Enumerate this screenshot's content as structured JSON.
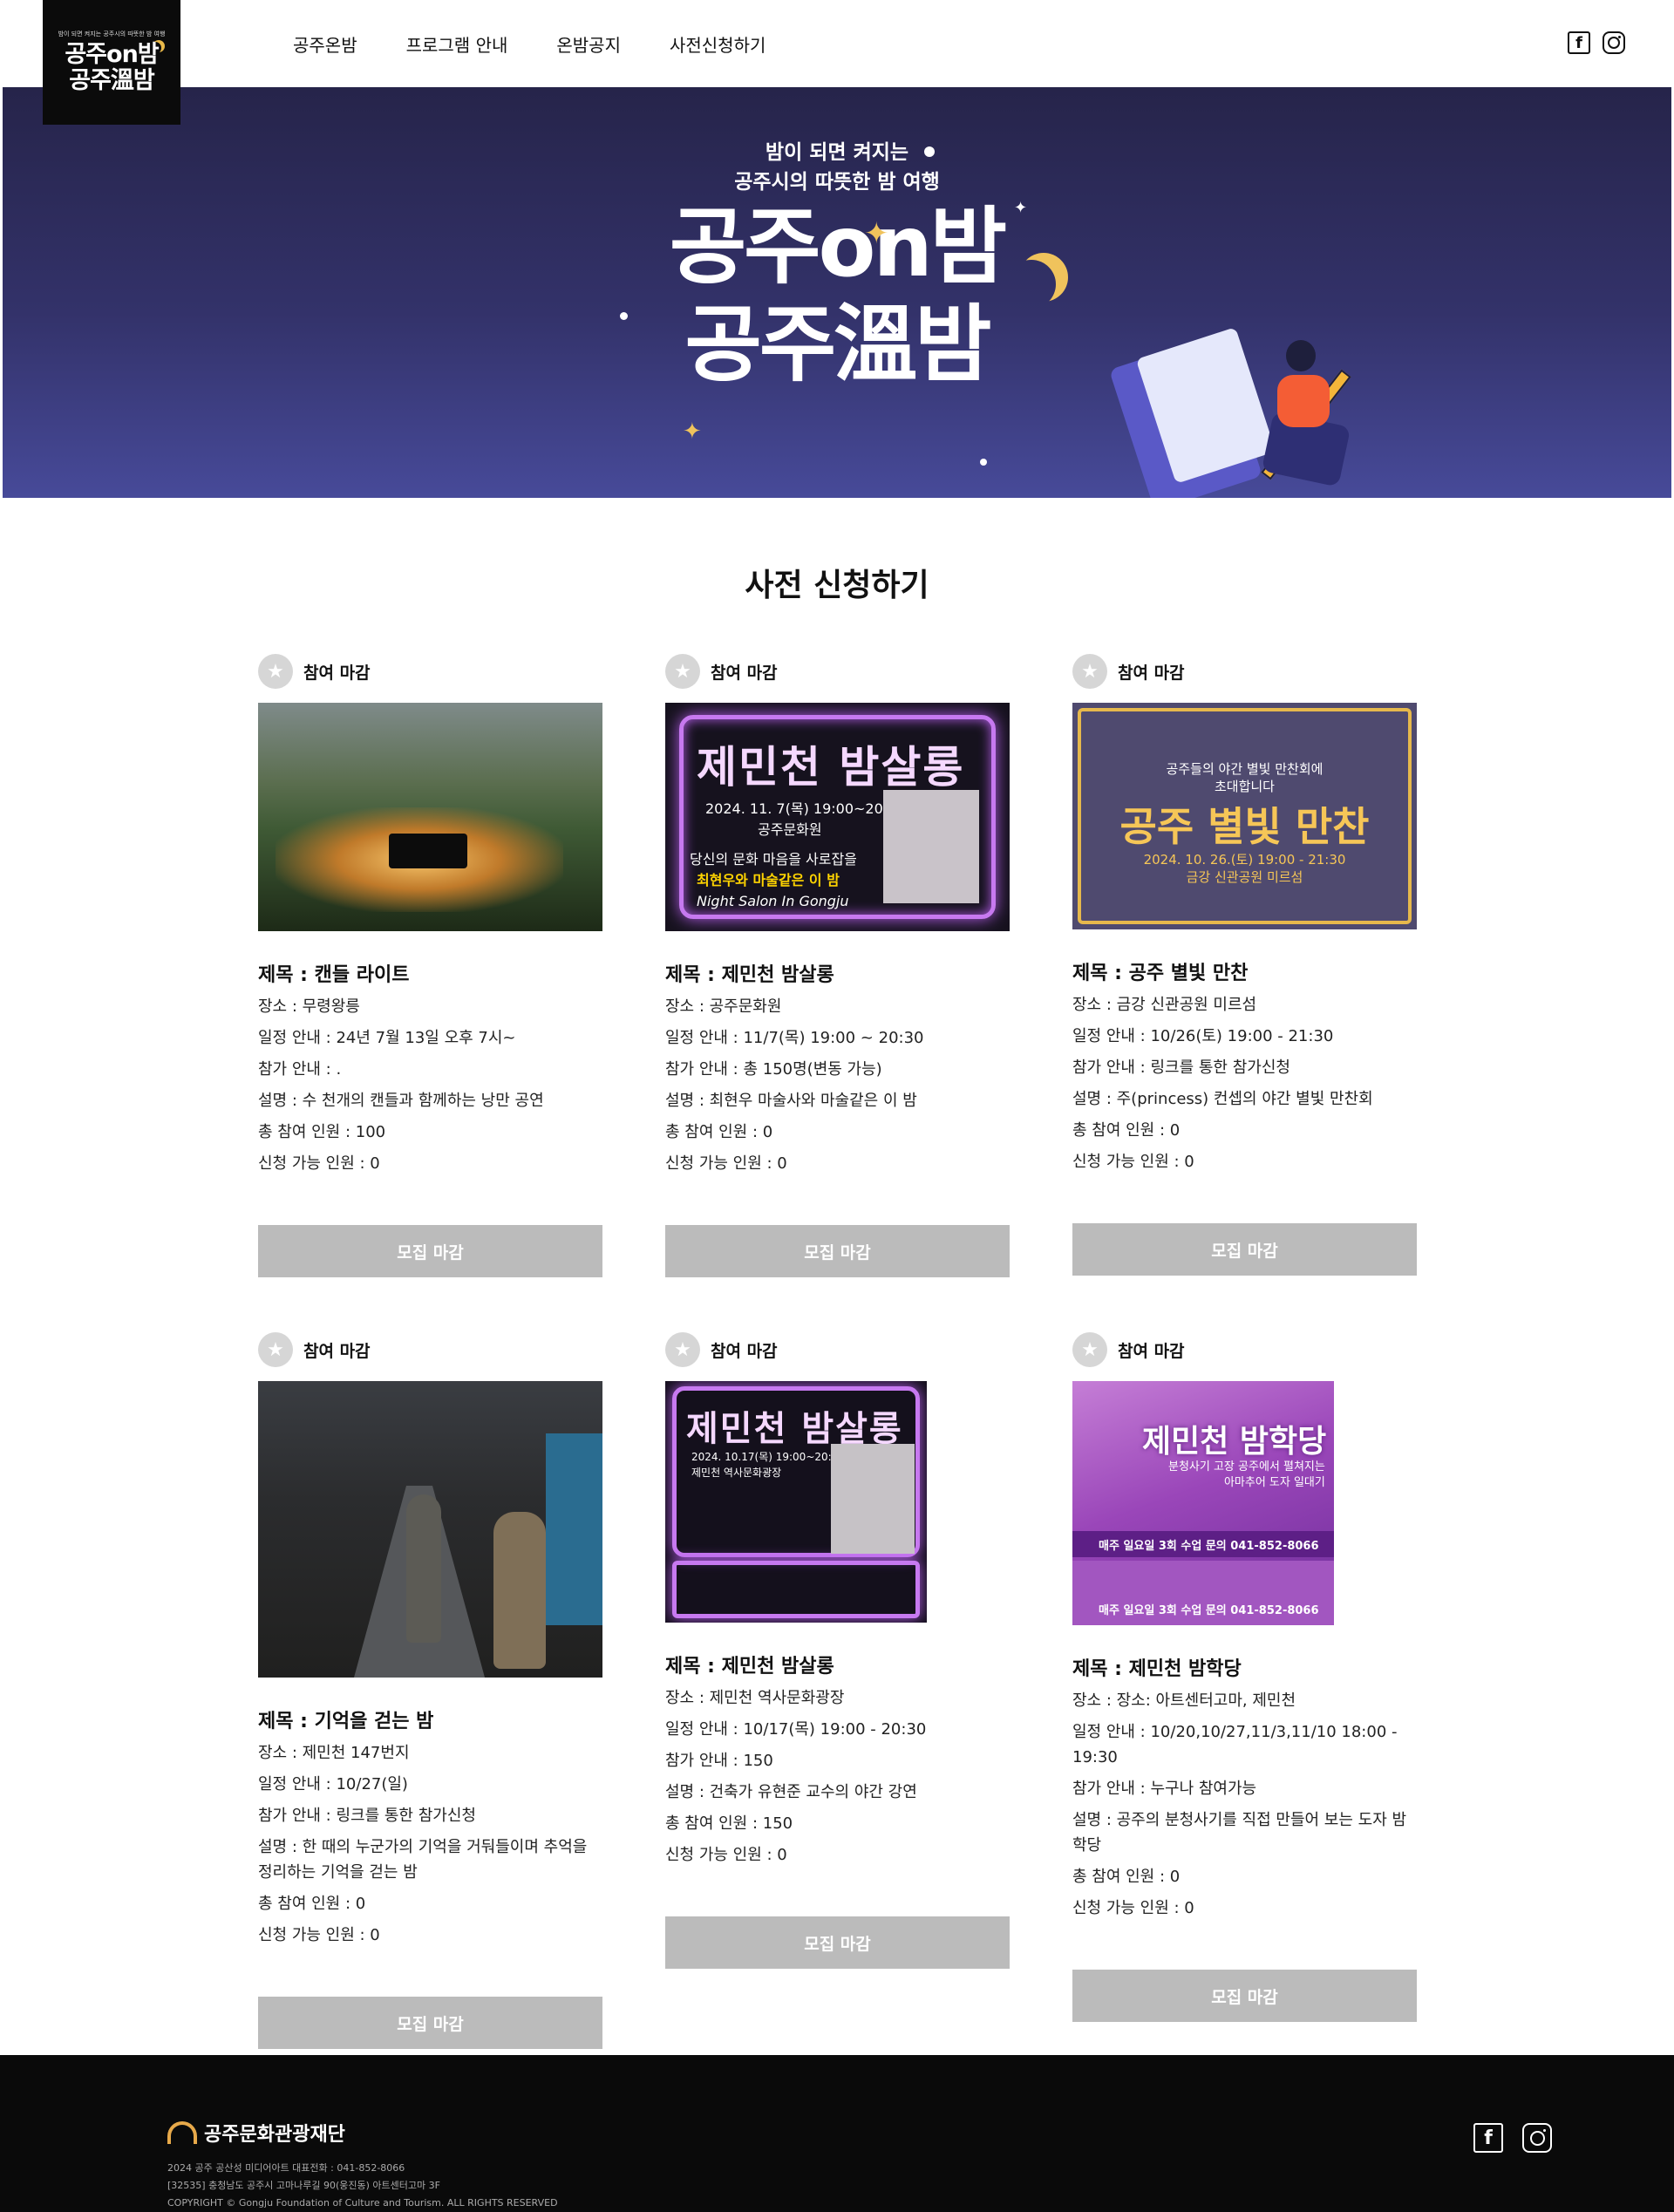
{
  "logo": {
    "tagline": "밤이 되면 켜지는 공주시의 따뜻한 밤 여행",
    "line1": "공주on밤",
    "line2": "공주溫밤"
  },
  "nav": [
    "공주온밤",
    "프로그램 안내",
    "온밤공지",
    "사전신청하기"
  ],
  "sns": {
    "facebook": "f",
    "instagram": ""
  },
  "hero": {
    "tag_line1": "밤이 되면 켜지는",
    "tag_line2": "공주시의 따뜻한 밤 여행",
    "title_line1": "공주on밤",
    "title_line2": "공주溫밤"
  },
  "section_title": "사전 신청하기",
  "status_label": "참여 마감",
  "button_label": "모집 마감",
  "cards": [
    {
      "title": "제목 : 캔들 라이트",
      "place": "장소 : 무령왕릉",
      "schedule": "일정 안내 : 24년 7월 13일 오후 7시~",
      "guide": "참가 안내 : .",
      "desc": "설명 : 수 천개의 캔들과 함께하는 낭만 공연",
      "total": "총 참여 인원 : 100",
      "available": "신청 가능 인원 : 0"
    },
    {
      "title": "제목 : 제민천 밤살롱",
      "place": "장소 : 공주문화원",
      "schedule": "일정 안내 : 11/7(목) 19:00 ~ 20:30",
      "guide": "참가 안내 : 총 150명(변동 가능)",
      "desc": "설명 : 최현우 마술사와 마술같은 이 밤",
      "total": "총 참여 인원 : 0",
      "available": "신청 가능 인원 : 0",
      "poster": {
        "title": "제민천 밤살롱",
        "date": "2024. 11. 7(목) 19:00~20:30",
        "venue": "공주문화원",
        "line1": "당신의 문화 마음을 사로잡을",
        "line2": "최현우와 마술같은 이 밤",
        "line3": "Night Salon In Gongju"
      }
    },
    {
      "title": "제목 : 공주 별빛 만찬",
      "place": "장소 : 금강 신관공원 미르섬",
      "schedule": "일정 안내 : 10/26(토) 19:00 - 21:30",
      "guide": "참가 안내 : 링크를 통한 참가신청",
      "desc": "설명 : 주(princess) 컨셉의 야간 별빛 만찬회",
      "total": "총 참여 인원 : 0",
      "available": "신청 가능 인원 : 0",
      "poster": {
        "sub1": "공주들의 야간 별빛 만찬회에",
        "sub2": "초대합니다",
        "title": "공주 별빛 만찬",
        "date": "2024. 10. 26.(토) 19:00 - 21:30",
        "venue": "금강 신관공원 미르섬"
      }
    },
    {
      "title": "제목 : 기억을 걷는 밤",
      "place": "장소 : 제민천 147번지",
      "schedule": "일정 안내 : 10/27(일)",
      "guide": "참가 안내 : 링크를 통한 참가신청",
      "desc": "설명 : 한 때의 누군가의 기억을 거둬들이며 추억을 정리하는 기억을 걷는 밤",
      "total": "총 참여 인원 : 0",
      "available": "신청 가능 인원 : 0"
    },
    {
      "title": "제목 : 제민천 밤살롱",
      "place": "장소 : 제민천 역사문화광장",
      "schedule": "일정 안내 : 10/17(목) 19:00 - 20:30",
      "guide": "참가 안내 : 150",
      "desc": "설명 : 건축가 유현준 교수의 야간 강연",
      "total": "총 참여 인원 : 150",
      "available": "신청 가능 인원 : 0",
      "poster": {
        "title": "제민천 밤살롱",
        "date": "2024. 10.17(목) 19:00~20:30",
        "venue": "제민천 역사문화광장"
      }
    },
    {
      "title": "제목 : 제민천 밤학당",
      "place": "장소 : 장소: 아트센터고마, 제민천",
      "schedule": "일정 안내 : 10/20,10/27,11/3,11/10 18:00 - 19:30",
      "guide": "참가 안내 : 누구나 참여가능",
      "desc": "설명 : 공주의 분청사기를 직접 만들어 보는 도자 밤학당",
      "total": "총 참여 인원 : 0",
      "available": "신청 가능 인원 : 0",
      "poster": {
        "title": "제민천 밤학당",
        "sub1": "분청사기 고장 공주에서 펼쳐지는",
        "sub2": "아마추어 도자 일대기",
        "band": "매주 일요일 3회 수업 문의 041-852-8066"
      }
    }
  ],
  "footer": {
    "org": "공주문화관광재단",
    "line1": "2024 공주 공산성 미디어아트 대표전화 : 041-852-8066",
    "line2": "[32535] 충청남도 공주시 고마나루길 90(웅진동) 아트센터고마 3F",
    "line3": "COPYRIGHT © Gongju Foundation of Culture and Tourism. ALL RIGHTS RESERVED"
  }
}
